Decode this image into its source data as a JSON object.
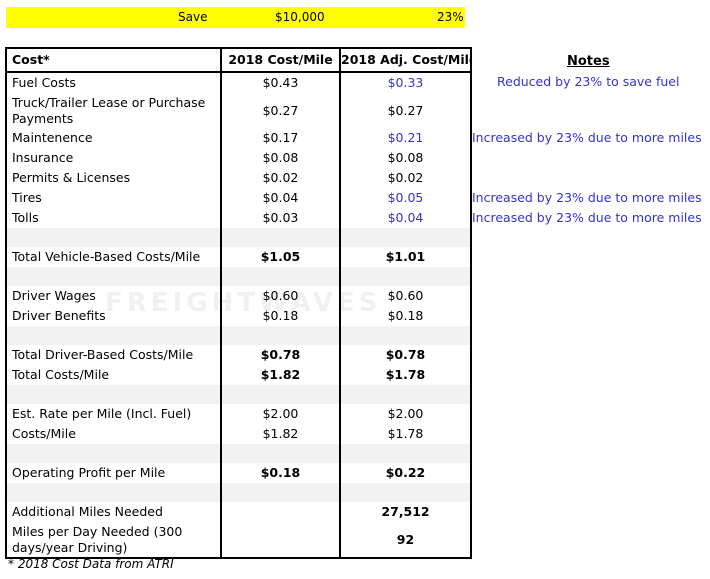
{
  "save_bar": {
    "label": "Save",
    "amount": "$10,000",
    "percent": "23%"
  },
  "table": {
    "headers": [
      "Cost*",
      "2018 Cost/Mile",
      "2018 Adj. Cost/Mile"
    ],
    "rows": [
      {
        "label": "Fuel Costs",
        "cost": "$0.43",
        "adj": "$0.33",
        "adj_blue": true
      },
      {
        "label": "Truck/Trailer Lease or Purchase Payments",
        "cost": "$0.27",
        "adj": "$0.27",
        "tall": true
      },
      {
        "label": "Maintenence",
        "cost": "$0.17",
        "adj": "$0.21",
        "adj_blue": true
      },
      {
        "label": "Insurance",
        "cost": "$0.08",
        "adj": "$0.08"
      },
      {
        "label": "Permits & Licenses",
        "cost": "$0.02",
        "adj": "$0.02"
      },
      {
        "label": "Tires",
        "cost": "$0.04",
        "adj": "$0.05",
        "adj_blue": true
      },
      {
        "label": "Tolls",
        "cost": "$0.03",
        "adj": "$0.04",
        "adj_blue": true
      },
      {
        "blank": true
      },
      {
        "label": "Total Vehicle-Based Costs/Mile",
        "cost": "$1.05",
        "adj": "$1.01",
        "bold": true
      },
      {
        "blank": true
      },
      {
        "label": "Driver Wages",
        "cost": "$0.60",
        "adj": "$0.60"
      },
      {
        "label": "Driver Benefits",
        "cost": "$0.18",
        "adj": "$0.18"
      },
      {
        "blank": true
      },
      {
        "label": "Total Driver-Based Costs/Mile",
        "cost": "$0.78",
        "adj": "$0.78",
        "bold": true
      },
      {
        "label": "Total Costs/Mile",
        "cost": "$1.82",
        "adj": "$1.78",
        "bold": true
      },
      {
        "blank": true
      },
      {
        "label": "Est. Rate per Mile (Incl. Fuel)",
        "cost": "$2.00",
        "adj": "$2.00"
      },
      {
        "label": "Costs/Mile",
        "cost": "$1.82",
        "adj": "$1.78"
      },
      {
        "blank": true
      },
      {
        "label": "Operating Profit per Mile",
        "cost": "$0.18",
        "adj": "$0.22",
        "bold": true
      },
      {
        "blank": true
      },
      {
        "label": "Additional Miles Needed",
        "cost": "",
        "adj": "27,512",
        "bold": true
      },
      {
        "label": "Miles per Day Needed (300 days/year Driving)",
        "cost": "",
        "adj": "92",
        "bold": true,
        "tall": true
      }
    ]
  },
  "notes": {
    "header": "Notes",
    "items": [
      {
        "text": "Reduced by 23% to save fuel"
      },
      {
        "text": "Increased by 23% due to more miles"
      },
      {
        "text": "Increased by 23% due to more miles"
      },
      {
        "text": "Increased by 23% due to more miles"
      }
    ]
  },
  "footnote": "* 2018 Cost Data from ATRI",
  "watermark": "FREIGHTWAVES",
  "colors": {
    "save_bar": "#ffff00",
    "adjusted_text": "#3333cc",
    "blank_row": "#f2f2f2"
  }
}
